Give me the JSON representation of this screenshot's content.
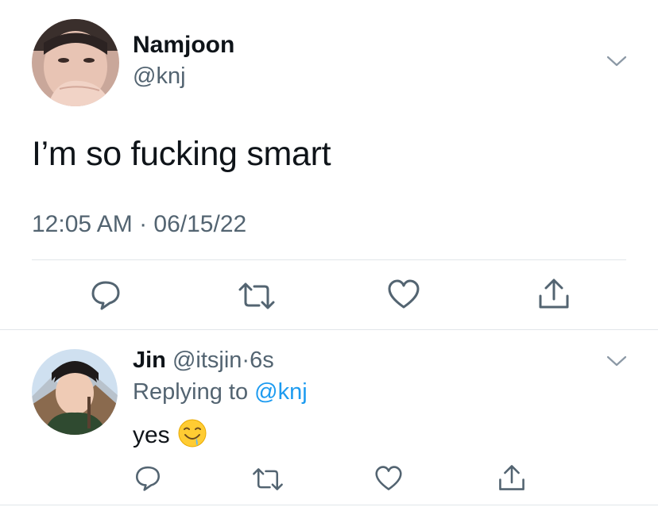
{
  "tweet": {
    "author": {
      "display_name": "Namjoon",
      "handle": "@knj"
    },
    "text": "I’m so fucking smart",
    "timestamp": "12:05 AM · 06/15/22",
    "actions": [
      "reply",
      "retweet",
      "like",
      "share"
    ]
  },
  "reply": {
    "author": {
      "display_name": "Jin",
      "handle": "@itsjin"
    },
    "separator": "·",
    "age": "6s",
    "replying_to_prefix": "Replying to ",
    "replying_to_handle": "@knj",
    "text": "yes",
    "emoji": "drooling-face",
    "actions": [
      "reply",
      "retweet",
      "like",
      "share"
    ]
  },
  "colors": {
    "text_primary": "#0f1419",
    "text_secondary": "#536471",
    "link": "#1d9bf0",
    "icon": "#536471",
    "divider": "#e1e6ea"
  }
}
